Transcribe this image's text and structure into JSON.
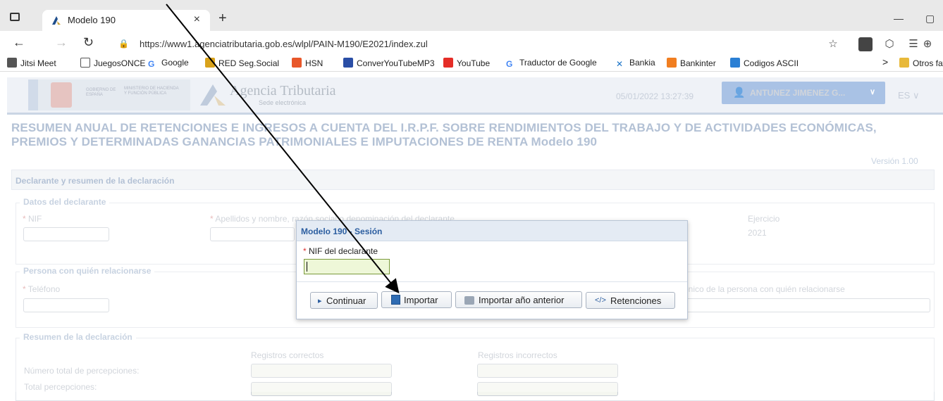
{
  "browser": {
    "tab_title": "Modelo 190",
    "tab_close": "×",
    "new_tab": "+",
    "url": "https://www1.agenciatributaria.gob.es/wlpl/PAIN-M190/E2021/index.zul",
    "bookmarks": [
      "Jitsi Meet",
      "JuegosONCE",
      "Google",
      "RED Seg.Social",
      "HSN",
      "ConverYouTubeMP3",
      "YouTube",
      "Traductor de Google",
      "Bankia",
      "Bankinter",
      "Codigos ASCII"
    ],
    "bookmarks_more": ">",
    "other_favorites": "Otros favor"
  },
  "header": {
    "gov_line1": "GOBIERNO DE ESPAÑA",
    "gov_line2": "MINISTERIO DE HACIENDA Y FUNCIÓN PÚBLICA",
    "agency_name": "Agencia Tributaria",
    "agency_sub": "Sede electrónica",
    "datetime": "05/01/2022 13:27:39",
    "user": "ANTUNEZ JIMENEZ G...",
    "lang": "ES"
  },
  "page": {
    "title": "RESUMEN ANUAL DE RETENCIONES E INGRESOS A CUENTA DEL I.R.P.F. SOBRE RENDIMIENTOS DEL TRABAJO Y DE ACTIVIDADES ECONÓMICAS, PREMIOS Y DETERMINADAS GANANCIAS PATRIMONIALES E IMPUTACIONES DE RENTA Modelo 190",
    "version": "Versión 1.00",
    "panel_header": "Declarante y resumen de la declaración",
    "declarante": {
      "legend": "Datos del declarante",
      "nif_label": "NIF",
      "nombre_label": "Apellidos y nombre, razón social o denominación del declarante",
      "ejercicio_label": "Ejercicio",
      "ejercicio_value": "2021"
    },
    "persona": {
      "legend": "Persona con quién relacionarse",
      "telefono_label": "Teléfono",
      "email_label": "ónico de la persona con quién relacionarse"
    },
    "resumen": {
      "legend": "Resumen de la declaración",
      "col_correctos": "Registros correctos",
      "col_incorrectos": "Registros incorrectos",
      "row1": "Número total de percepciones:",
      "row2": "Total percepciones:"
    }
  },
  "modal": {
    "title": "Modelo 190 - Sesión",
    "nif_label": "NIF del declarante",
    "nif_value": "",
    "btn_continuar": "Continuar",
    "btn_importar": "Importar",
    "btn_importar_anterior": "Importar año anterior",
    "btn_retenciones": "Retenciones"
  }
}
